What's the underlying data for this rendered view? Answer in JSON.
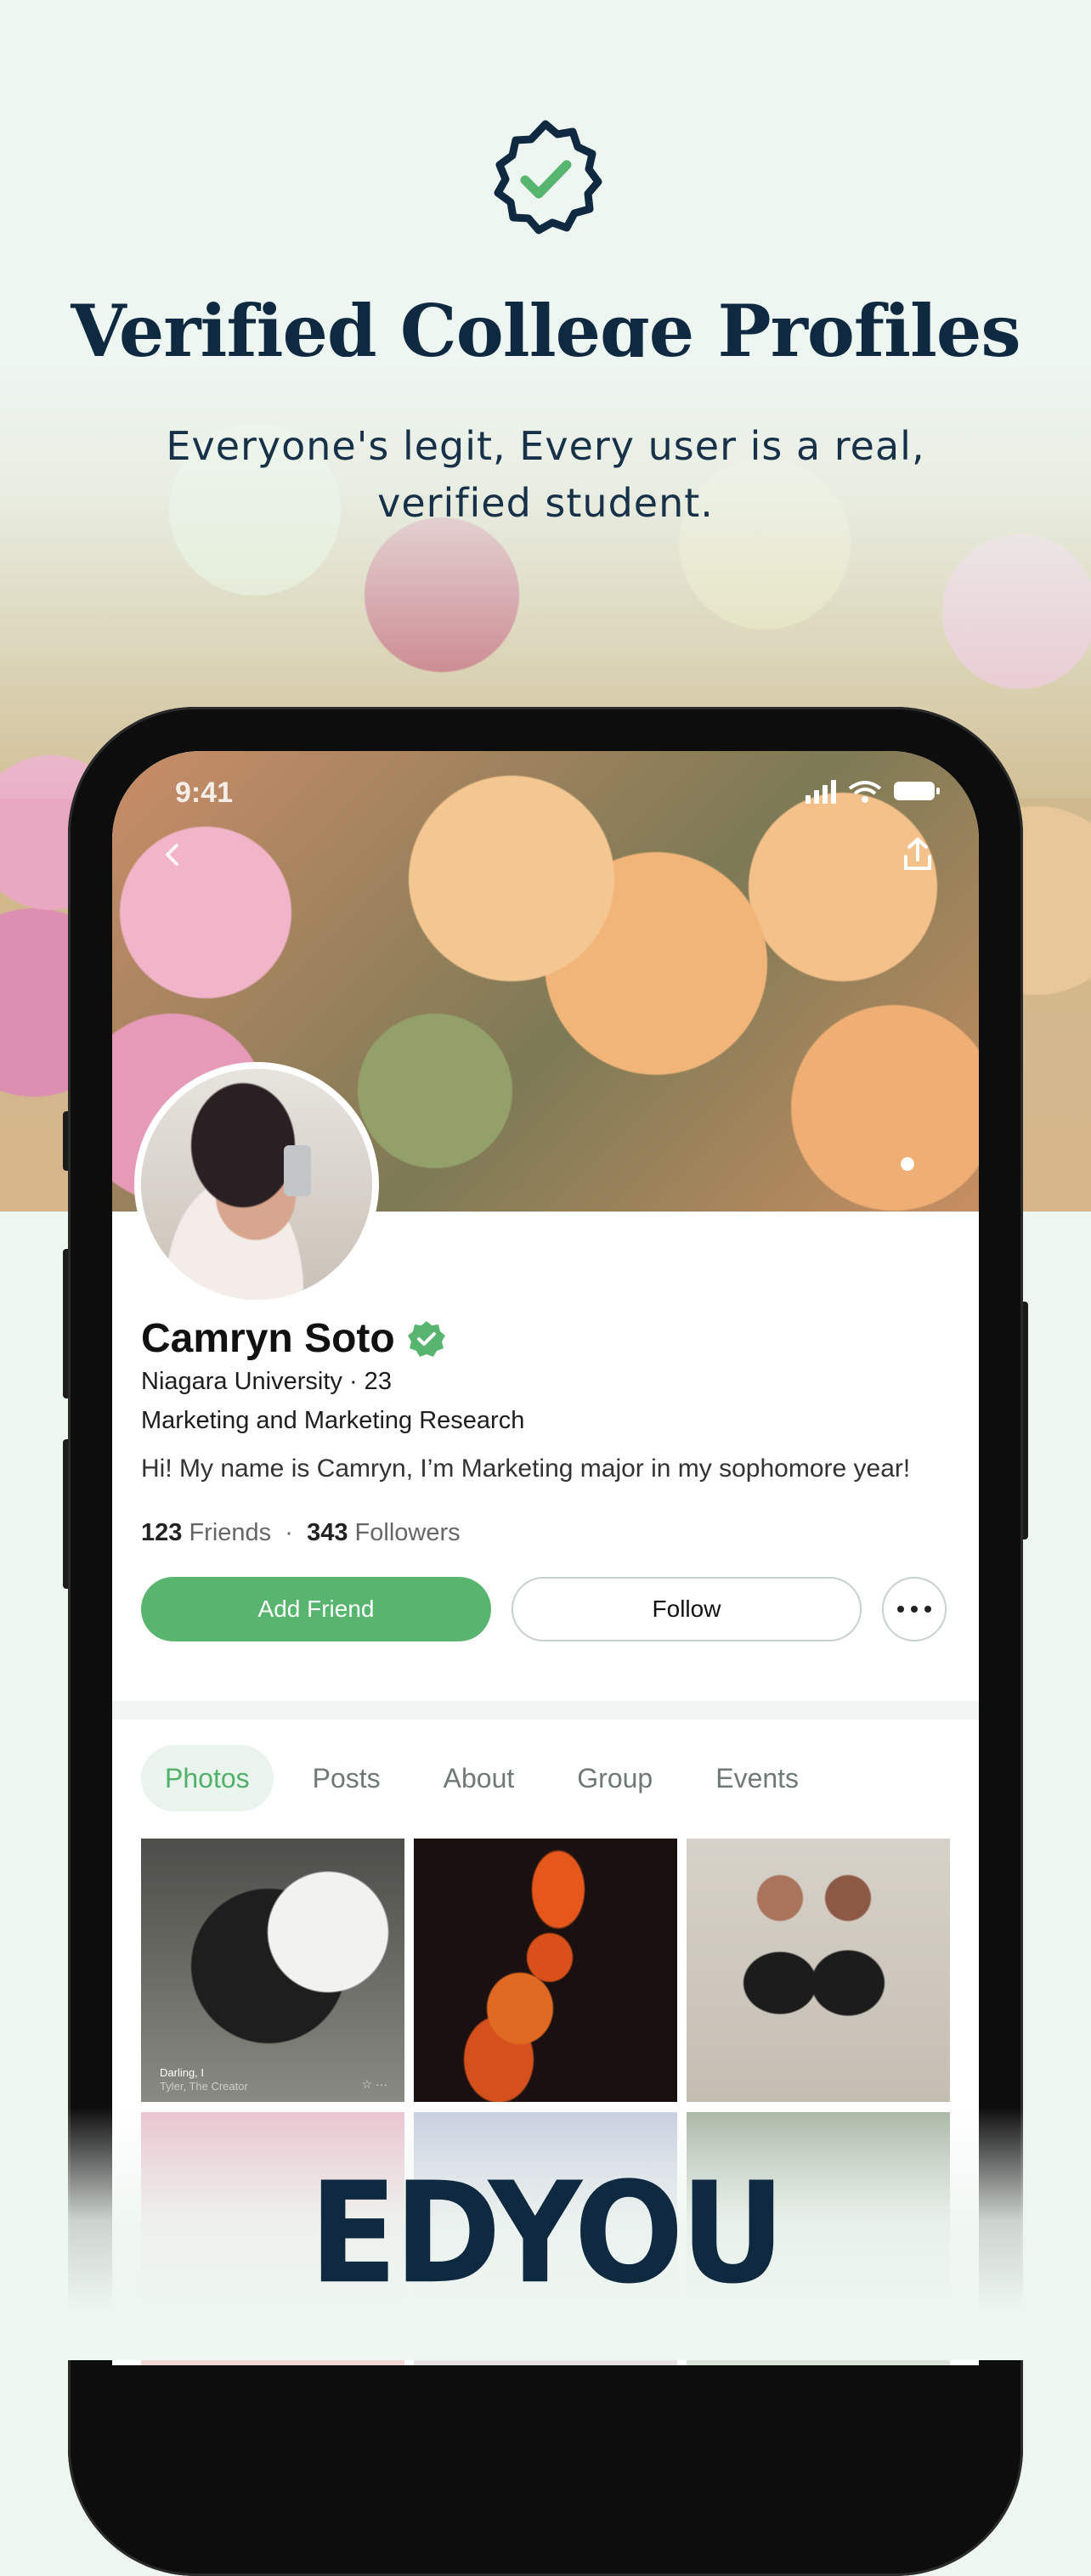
{
  "marketing": {
    "headline": "Verified College Profiles",
    "subhead": "Everyone's legit, Every user is a real, verified student.",
    "badge_icon": "verified-badge-icon",
    "brand_logo": "EDYOU"
  },
  "status_bar": {
    "time": "9:41"
  },
  "profile": {
    "name": "Camryn Soto",
    "school_line": "Niagara University · 23",
    "major": "Marketing and Marketing Research",
    "bio": "Hi! My name is Camryn, I’m Marketing major in my sophomore year!",
    "friends_count": "123",
    "friends_label": "Friends",
    "separator": "·",
    "followers_count": "343",
    "followers_label": "Followers"
  },
  "actions": {
    "add_friend": "Add Friend",
    "follow": "Follow",
    "more": "more-options-icon"
  },
  "tabs": [
    {
      "label": "Photos",
      "active": true
    },
    {
      "label": "Posts"
    },
    {
      "label": "About"
    },
    {
      "label": "Group"
    },
    {
      "label": "Events"
    }
  ],
  "photos": [
    {
      "caption": "Darling, I",
      "subcaption": "Tyler, The Creator"
    }
  ],
  "colors": {
    "accent_green": "#58b56f",
    "navy": "#0f2a40",
    "background": "#eef6f1"
  }
}
